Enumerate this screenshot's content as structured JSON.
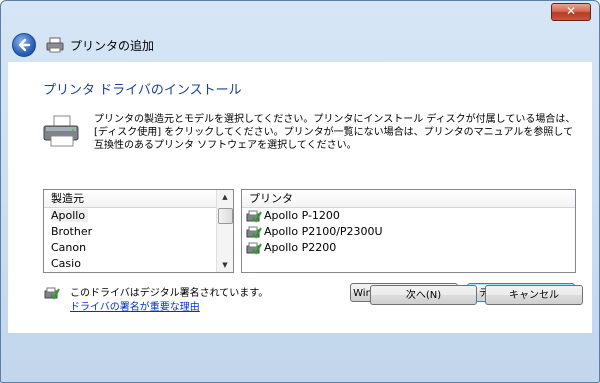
{
  "window": {
    "title": "プリンタの追加",
    "close_label": "✕"
  },
  "page": {
    "heading": "プリンタ ドライバのインストール",
    "description": "プリンタの製造元とモデルを選択してください。プリンタにインストール ディスクが付属している場合は、[ディスク使用] をクリックしてください。プリンタが一覧にない場合は、プリンタのマニュアルを参照して互換性のあるプリンタ ソフトウェアを選択してください。"
  },
  "manufacturers": {
    "header": "製造元",
    "items": [
      "Apollo",
      "Brother",
      "Canon",
      "Casio"
    ],
    "selected": "Apollo"
  },
  "printers": {
    "header": "プリンタ",
    "items": [
      "Apollo P-1200",
      "Apollo P2100/P2300U",
      "Apollo P2200"
    ]
  },
  "signature": {
    "text": "このドライバはデジタル署名されています。",
    "link": "ドライバの署名が重要な理由"
  },
  "buttons": {
    "windows_update": "Windows Update(W)",
    "have_disk": "ディスク使用(H)...",
    "next": "次へ(N)",
    "cancel": "キャンセル"
  },
  "colors": {
    "heading": "#1e3f96",
    "link": "#0033cc",
    "close": "#c9553a"
  }
}
